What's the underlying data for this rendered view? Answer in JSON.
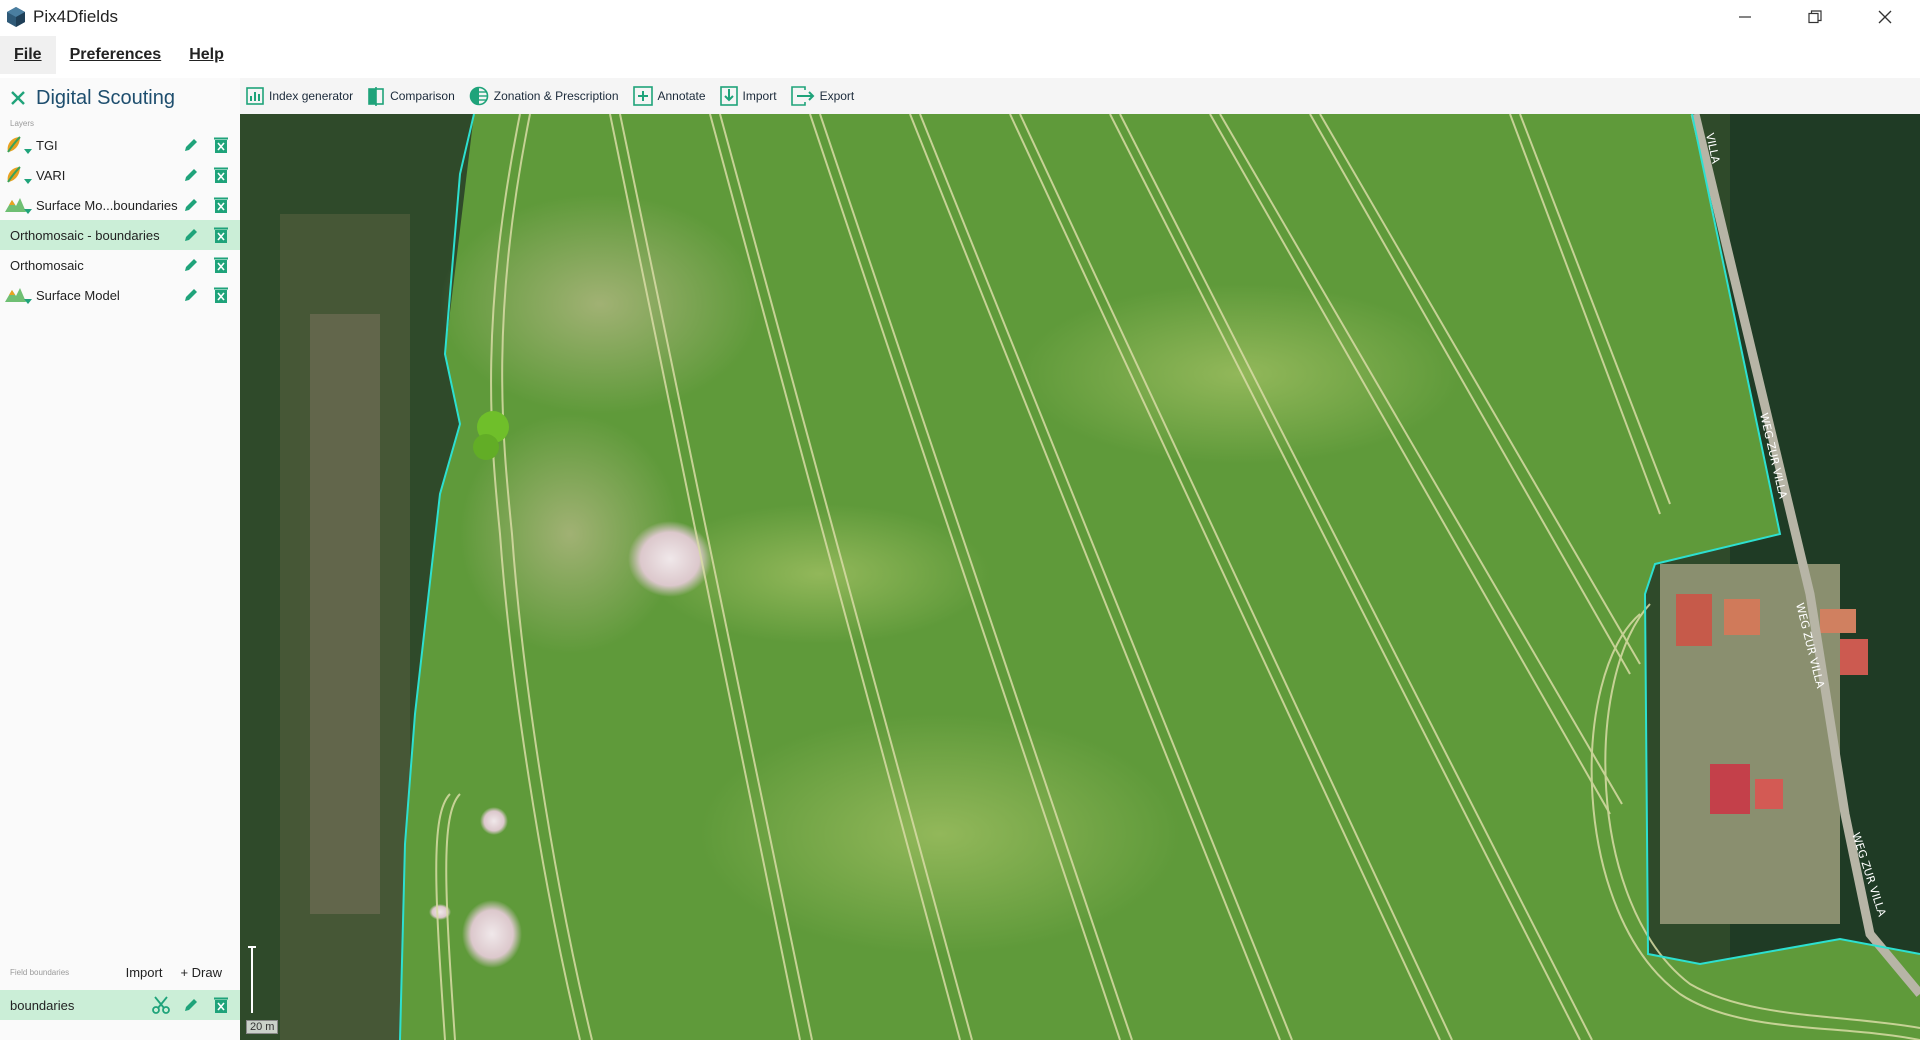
{
  "window": {
    "title": "Pix4Dfields"
  },
  "menu": {
    "items": [
      "File",
      "Preferences",
      "Help"
    ]
  },
  "sidebar": {
    "module_title": "Digital Scouting",
    "layers_caption": "Layers",
    "layers": [
      {
        "label": "TGI",
        "icon": "index-leaf-icon"
      },
      {
        "label": "VARI",
        "icon": "index-leaf-icon"
      },
      {
        "label": "Surface Mo...boundaries",
        "icon": "surface-model-icon"
      },
      {
        "label": "Orthomosaic - boundaries",
        "icon": "none",
        "selected": true
      },
      {
        "label": "Orthomosaic",
        "icon": "none"
      },
      {
        "label": "Surface Model",
        "icon": "surface-model-icon"
      }
    ],
    "field_boundaries": {
      "caption": "Field boundaries",
      "import_label": "Import",
      "draw_label": "+ Draw",
      "items": [
        "boundaries"
      ]
    }
  },
  "toolbar": {
    "tools": [
      {
        "label": "Index generator",
        "icon": "index-chart-icon"
      },
      {
        "label": "Comparison",
        "icon": "comparison-icon"
      },
      {
        "label": "Zonation & Prescription",
        "icon": "zonation-icon"
      },
      {
        "label": "Annotate",
        "icon": "annotate-plus-icon"
      },
      {
        "label": "Import",
        "icon": "import-icon"
      },
      {
        "label": "Export",
        "icon": "export-icon"
      }
    ]
  },
  "map": {
    "scale_label": "20 m",
    "road_labels": [
      "VILLA",
      "WEG ZUR VILLA",
      "WEG ZUR VILLA",
      "WEG ZUR VILLA"
    ]
  },
  "colors": {
    "accent": "#1fa37a",
    "selected_row": "#cbeed7",
    "boundary": "#2de0d0",
    "title_text": "#1e4e6e"
  }
}
